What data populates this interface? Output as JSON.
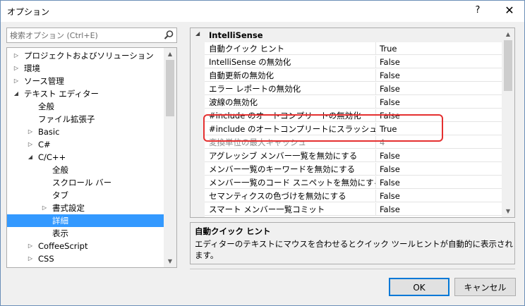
{
  "window": {
    "title": "オプション",
    "help": "?",
    "close": "✕"
  },
  "search": {
    "placeholder": "検索オプション (Ctrl+E)"
  },
  "tree": {
    "items": [
      {
        "label": "プロジェクトおよびソリューション",
        "toggle": "▷"
      },
      {
        "label": "環境",
        "toggle": "▷"
      },
      {
        "label": "ソース管理",
        "toggle": "▷"
      },
      {
        "label": "テキスト エディター",
        "toggle": "◢"
      },
      {
        "label": "全般",
        "toggle": ""
      },
      {
        "label": "ファイル拡張子",
        "toggle": ""
      },
      {
        "label": "Basic",
        "toggle": "▷"
      },
      {
        "label": "C#",
        "toggle": "▷"
      },
      {
        "label": "C/C++",
        "toggle": "◢"
      },
      {
        "label": "全般",
        "toggle": ""
      },
      {
        "label": "スクロール バー",
        "toggle": ""
      },
      {
        "label": "タブ",
        "toggle": ""
      },
      {
        "label": "書式設定",
        "toggle": "▷"
      },
      {
        "label": "詳細",
        "toggle": "",
        "selected": true
      },
      {
        "label": "表示",
        "toggle": ""
      },
      {
        "label": "CoffeeScript",
        "toggle": "▷"
      },
      {
        "label": "CSS",
        "toggle": "▷"
      }
    ]
  },
  "grid": {
    "category": "IntelliSense",
    "category_toggle": "◢",
    "rows": [
      {
        "name": "自動クイック ヒント",
        "value": "True"
      },
      {
        "name": "IntelliSense の無効化",
        "value": "False"
      },
      {
        "name": "自動更新の無効化",
        "value": "False"
      },
      {
        "name": "エラー レポートの無効化",
        "value": "False"
      },
      {
        "name": "波線の無効化",
        "value": "False"
      },
      {
        "name": "#include のオートコンプリートの無効化",
        "value": "False"
      },
      {
        "name": "#include のオートコンプリートにスラッシュを使用",
        "value": "True"
      },
      {
        "name": "変換単位の最大キャッシュ",
        "value": "4"
      },
      {
        "name": "アグレッシブ メンバー一覧を無効にする",
        "value": "False"
      },
      {
        "name": "メンバー一覧のキーワードを無効にする",
        "value": "False"
      },
      {
        "name": "メンバー一覧のコード スニペットを無効にする",
        "value": "False"
      },
      {
        "name": "セマンティクスの色づけを無効にする",
        "value": "False"
      },
      {
        "name": "スマート メンバー一覧コミット",
        "value": "False"
      }
    ]
  },
  "description": {
    "title": "自動クイック ヒント",
    "text": "エディターのテキストにマウスを合わせるとクイック ツールヒントが自動的に表示されます。"
  },
  "buttons": {
    "ok": "OK",
    "cancel": "キャンセル"
  },
  "colors": {
    "selection": "#3399ff",
    "highlight_box": "#e53030",
    "ok_border": "#0078d7"
  }
}
